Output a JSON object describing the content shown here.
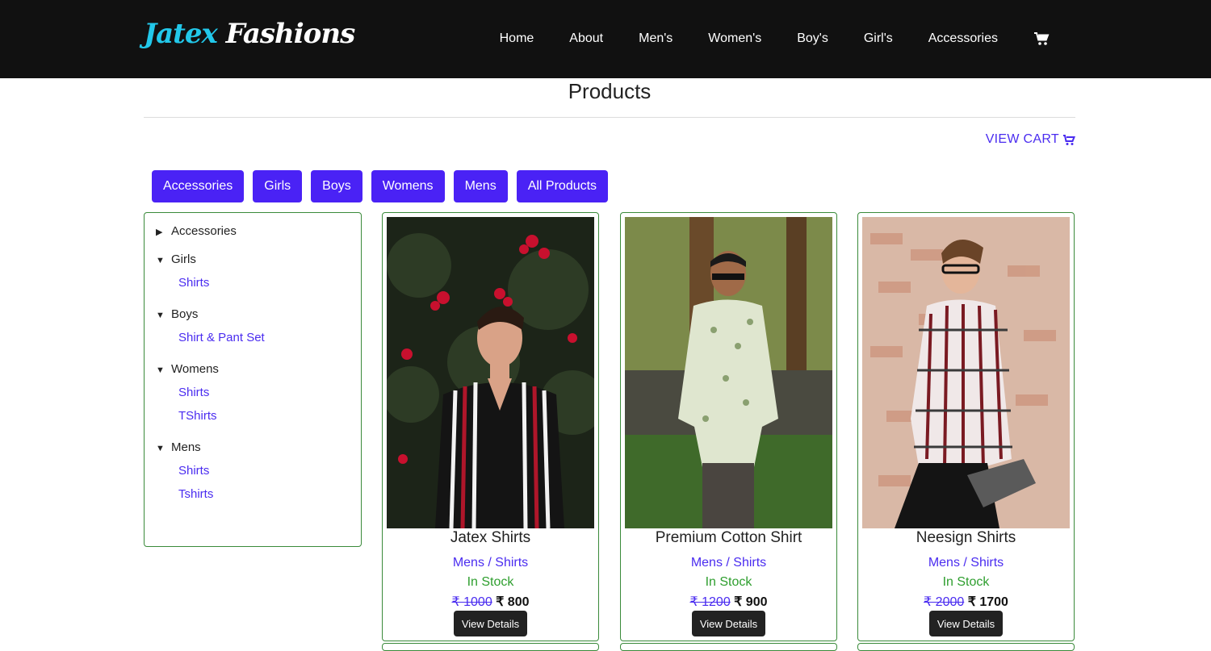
{
  "brand": {
    "part1": "Jatex",
    "part2": "Fashions"
  },
  "nav": [
    "Home",
    "About",
    "Men's",
    "Women's",
    "Boy's",
    "Girl's",
    "Accessories"
  ],
  "page_title": "Products",
  "view_cart": "VIEW CART",
  "filters": [
    "Accessories",
    "Girls",
    "Boys",
    "Womens",
    "Mens",
    "All Products"
  ],
  "sidebar": {
    "accessories": "Accessories",
    "girls": {
      "label": "Girls",
      "sub": [
        "Shirts"
      ]
    },
    "boys": {
      "label": "Boys",
      "sub": [
        "Shirt & Pant Set"
      ]
    },
    "womens": {
      "label": "Womens",
      "sub": [
        "Shirts",
        "TShirts"
      ]
    },
    "mens": {
      "label": "Mens",
      "sub": [
        "Shirts",
        "Tshirts"
      ]
    }
  },
  "products": [
    {
      "name": "Jatex Shirts",
      "cat": "Mens",
      "sub": "Shirts",
      "stock": "In Stock",
      "old": "₹ 1000",
      "new": "₹ 800",
      "btn": "View Details"
    },
    {
      "name": "Premium Cotton Shirt",
      "cat": "Mens",
      "sub": "Shirts",
      "stock": "In Stock",
      "old": "₹ 1200",
      "new": "₹ 900",
      "btn": "View Details"
    },
    {
      "name": "Neesign Shirts",
      "cat": "Mens",
      "sub": "Shirts",
      "stock": "In Stock",
      "old": "₹ 2000",
      "new": "₹ 1700",
      "btn": "View Details"
    }
  ],
  "colors": {
    "accent": "#4a22f5",
    "nav_bg": "#111111",
    "stock": "#2e9e2e",
    "card_border": "#3a8a3a",
    "logo": "#22c8ea"
  }
}
